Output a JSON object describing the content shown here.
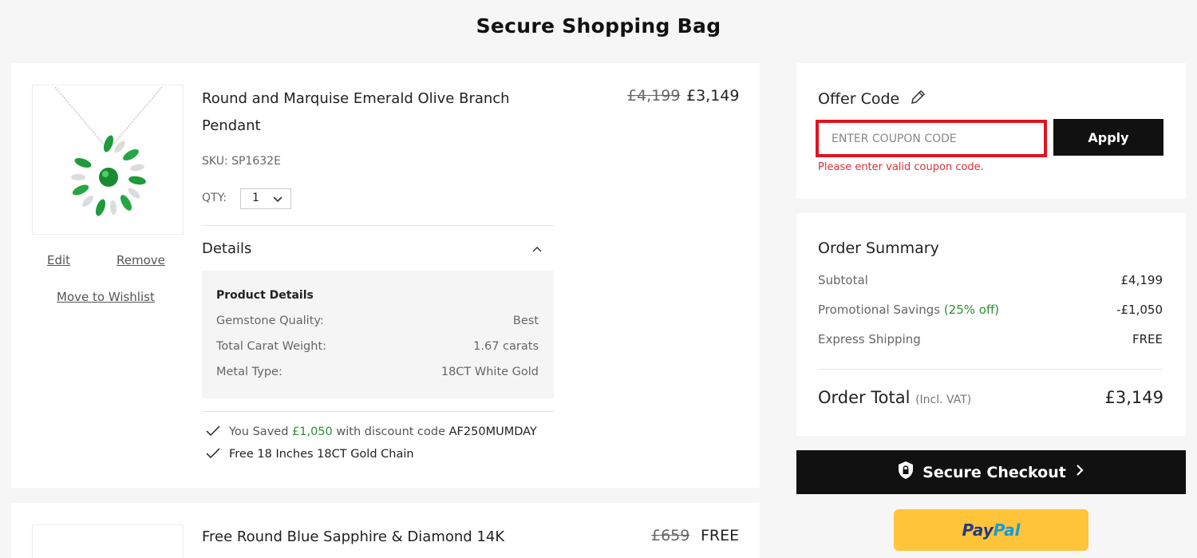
{
  "page": {
    "title": "Secure Shopping Bag"
  },
  "item1": {
    "name": "Round and Marquise Emerald Olive Branch Pendant",
    "price_original": "£4,199",
    "price_current": "£3,149",
    "sku": "SKU: SP1632E",
    "qty_label": "QTY:",
    "qty_value": "1",
    "edit_label": "Edit",
    "remove_label": "Remove",
    "wishlist_label": "Move to Wishlist",
    "details_label": "Details",
    "details_title": "Product Details",
    "details": [
      {
        "key": "Gemstone Quality:",
        "value": "Best"
      },
      {
        "key": "Total Carat Weight:",
        "value": "1.67 carats"
      },
      {
        "key": "Metal Type:",
        "value": "18CT White Gold"
      }
    ],
    "benefit_saved_prefix": "You Saved",
    "benefit_saved_amount": "£1,050",
    "benefit_saved_middle": "with discount code",
    "benefit_saved_code": "AF250MUMDAY",
    "benefit_chain": "Free 18 Inches 18CT Gold Chain"
  },
  "item2": {
    "name": "Free Round Blue Sapphire & Diamond 14K",
    "price_original": "£659",
    "price_current": "FREE"
  },
  "offer": {
    "title": "Offer Code",
    "placeholder": "ENTER COUPON CODE",
    "apply_label": "Apply",
    "error": "Please enter valid coupon code."
  },
  "summary": {
    "title": "Order Summary",
    "subtotal_label": "Subtotal",
    "subtotal_value": "£4,199",
    "savings_label": "Promotional Savings",
    "savings_pct": "(25% off)",
    "savings_value": "-£1,050",
    "shipping_label": "Express Shipping",
    "shipping_value": "FREE",
    "total_label": "Order Total",
    "total_note": "(Incl. VAT)",
    "total_value": "£3,149"
  },
  "checkout": {
    "label": "Secure Checkout"
  },
  "paypal": {
    "part1": "Pay",
    "part2": "Pal"
  },
  "colors": {
    "accent_green": "#2d8f35",
    "error_red": "#e2121f",
    "paypal_yellow": "#ffc439"
  }
}
